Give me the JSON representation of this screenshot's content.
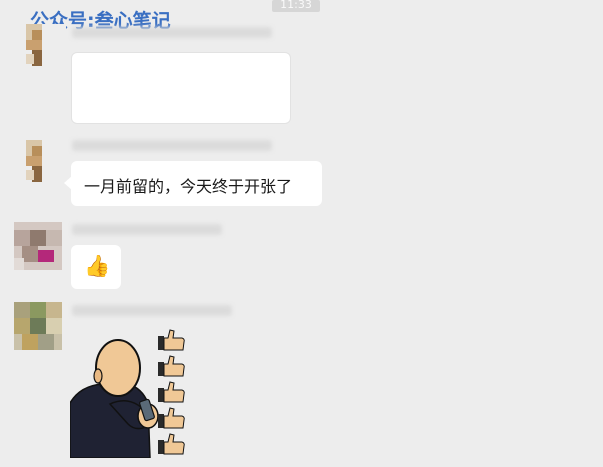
{
  "watermark": {
    "text": "公众号:叁心笔记"
  },
  "status": {
    "time": "11:33"
  },
  "messages": [
    {
      "id": 1,
      "type": "card",
      "sender_blurred": true
    },
    {
      "id": 2,
      "type": "text",
      "text": "一月前留的，今天终于开张了",
      "sender_blurred": true
    },
    {
      "id": 3,
      "type": "emoji",
      "emoji_name": "thumbs-up-icon",
      "emoji_glyph": "👍",
      "sender_blurred": true
    },
    {
      "id": 4,
      "type": "sticker",
      "sticker_name": "phone-man-thumbs-up-sticker",
      "sender_blurred": true
    }
  ],
  "colors": {
    "chat_bg": "#ededed",
    "bubble_bg": "#ffffff",
    "watermark": "#3a6fc2"
  }
}
